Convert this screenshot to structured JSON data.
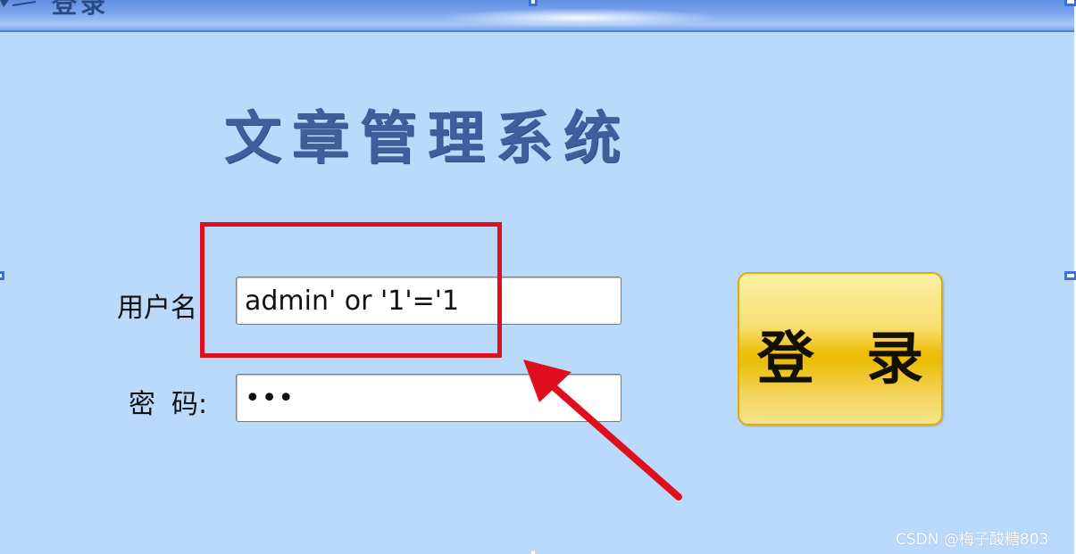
{
  "window": {
    "title": "登录"
  },
  "app": {
    "title": "文章管理系统"
  },
  "form": {
    "username_label": "用户名:",
    "username_value": "admin' or '1'='1",
    "password_label_1": "密",
    "password_label_2": "码:",
    "password_value": "•••",
    "login_button_label": "登 录"
  },
  "annotations": {
    "highlight_color": "#e00f1e",
    "arrow_color": "#e00f1e"
  },
  "watermark": {
    "text": "CSDN @梅子酸糖803"
  },
  "colors": {
    "panel_background": "#badafc",
    "titlebar": "#7ea6ec",
    "app_title": "#3f5f9c",
    "login_button": "#efbf0e"
  }
}
